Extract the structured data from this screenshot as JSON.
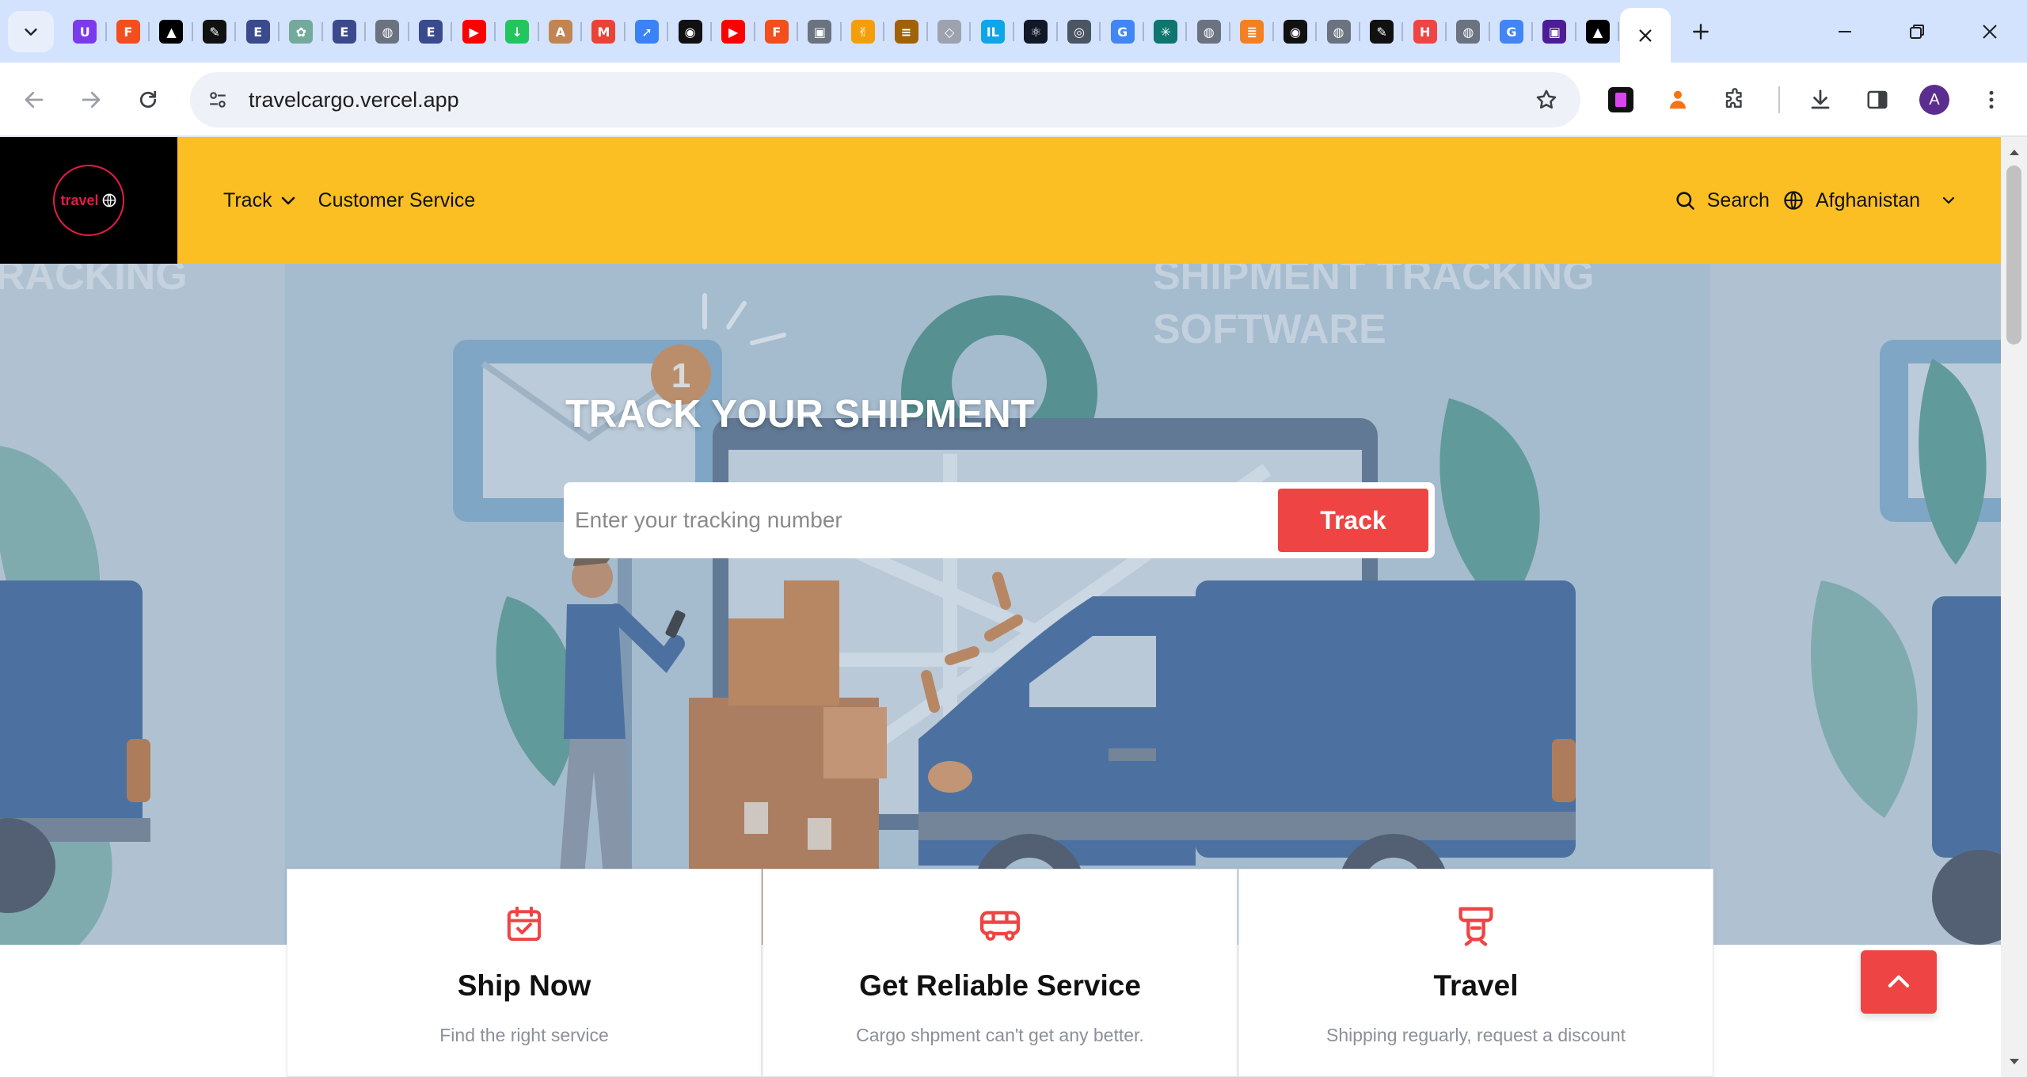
{
  "browser": {
    "tabs_favicons": [
      {
        "name": "ublock-icon",
        "bg": "#7c3aed",
        "glyph": "U"
      },
      {
        "name": "figma-icon",
        "bg": "#f24e1e",
        "glyph": "F"
      },
      {
        "name": "vercel-icon",
        "bg": "#000000",
        "glyph": "▲"
      },
      {
        "name": "dnd-icon",
        "bg": "#111111",
        "glyph": "✎"
      },
      {
        "name": "ebsco-icon",
        "bg": "#3b4a8c",
        "glyph": "E"
      },
      {
        "name": "chatgpt-icon",
        "bg": "#74aa9c",
        "glyph": "✿"
      },
      {
        "name": "ebsco-icon",
        "bg": "#3b4a8c",
        "glyph": "E"
      },
      {
        "name": "globe-icon",
        "bg": "#6b7280",
        "glyph": "◍"
      },
      {
        "name": "ebsco-icon",
        "bg": "#3b4a8c",
        "glyph": "E"
      },
      {
        "name": "youtube-icon",
        "bg": "#ff0000",
        "glyph": "▶"
      },
      {
        "name": "download-green-icon",
        "bg": "#22c55e",
        "glyph": "↓"
      },
      {
        "name": "anthropic-icon",
        "bg": "#c08552",
        "glyph": "A"
      },
      {
        "name": "gmail-icon",
        "bg": "#ea4335",
        "glyph": "M"
      },
      {
        "name": "rocket-icon",
        "bg": "#3b82f6",
        "glyph": "➚"
      },
      {
        "name": "github-icon",
        "bg": "#111111",
        "glyph": "◉"
      },
      {
        "name": "youtube-icon",
        "bg": "#ff0000",
        "glyph": "▶"
      },
      {
        "name": "figma-icon",
        "bg": "#f24e1e",
        "glyph": "F"
      },
      {
        "name": "box-icon",
        "bg": "#6b7280",
        "glyph": "▣"
      },
      {
        "name": "hand-icon",
        "bg": "#f59e0b",
        "glyph": "✌"
      },
      {
        "name": "burger-icon",
        "bg": "#a16207",
        "glyph": "≡"
      },
      {
        "name": "cube-icon",
        "bg": "#9ca3af",
        "glyph": "◇"
      },
      {
        "name": "intellij-icon",
        "bg": "#0ea5e9",
        "glyph": "IL"
      },
      {
        "name": "react-icon",
        "bg": "#111827",
        "glyph": "⚛"
      },
      {
        "name": "chrome-icon",
        "bg": "#4b5563",
        "glyph": "◎"
      },
      {
        "name": "google-icon",
        "bg": "#4285f4",
        "glyph": "G"
      },
      {
        "name": "spark-icon",
        "bg": "#0f766e",
        "glyph": "✳"
      },
      {
        "name": "globe-icon",
        "bg": "#6b7280",
        "glyph": "◍"
      },
      {
        "name": "stackoverflow-icon",
        "bg": "#f48024",
        "glyph": "≣"
      },
      {
        "name": "github-icon",
        "bg": "#111111",
        "glyph": "◉"
      },
      {
        "name": "globe-icon",
        "bg": "#6b7280",
        "glyph": "◍"
      },
      {
        "name": "dnd-icon",
        "bg": "#111111",
        "glyph": "✎"
      },
      {
        "name": "hackerrank-icon",
        "bg": "#ef4444",
        "glyph": "H"
      },
      {
        "name": "globe-icon",
        "bg": "#6b7280",
        "glyph": "◍"
      },
      {
        "name": "google-icon",
        "bg": "#4285f4",
        "glyph": "G"
      },
      {
        "name": "box-icon",
        "bg": "#4c1d95",
        "glyph": "▣"
      },
      {
        "name": "vercel-icon",
        "bg": "#000000",
        "glyph": "▲"
      }
    ],
    "url": "travelcargo.vercel.app",
    "avatar_letter": "A"
  },
  "site": {
    "logo_text": "travel",
    "nav": {
      "track_label": "Track",
      "customer_service_label": "Customer Service",
      "search_label": "Search",
      "country_label": "Afghanistan"
    },
    "hero": {
      "title": "TRACK YOUR SHIPMENT",
      "input_placeholder": "Enter your tracking number",
      "button_label": "Track",
      "bg_text_left": "RACKING",
      "bg_text_right_1": "SHIPMENT TRACKING",
      "bg_text_right_2": "SOFTWARE",
      "badge_number": "1"
    },
    "features": [
      {
        "icon": "calendar-check-icon",
        "title": "Ship Now",
        "desc": "Find the right service"
      },
      {
        "icon": "bus-icon",
        "title": "Get Reliable Service",
        "desc": "Cargo shpment can't get any better."
      },
      {
        "icon": "train-icon",
        "title": "Travel",
        "desc": "Shipping reguarly, request a discount"
      }
    ]
  },
  "colors": {
    "header_yellow": "#fbbf24",
    "accent_red": "#ef4444",
    "logo_red": "#e11d48",
    "tabstrip_blue": "#d3e3fd"
  }
}
